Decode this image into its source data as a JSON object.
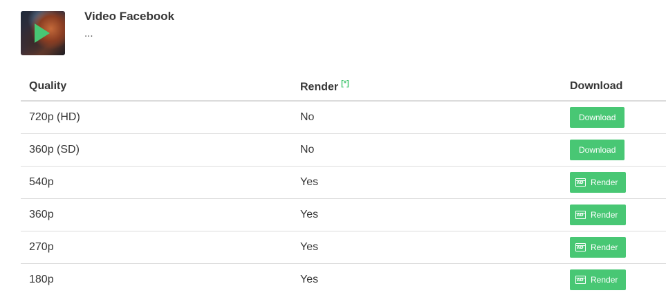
{
  "header": {
    "title": "Video Facebook",
    "subtitle": "..."
  },
  "table": {
    "headers": {
      "quality": "Quality",
      "render": "Render",
      "render_note": "[*]",
      "download": "Download"
    },
    "rows": [
      {
        "quality": "720p (HD)",
        "render": "No",
        "action": "Download"
      },
      {
        "quality": "360p (SD)",
        "render": "No",
        "action": "Download"
      },
      {
        "quality": "540p",
        "render": "Yes",
        "action": "Render"
      },
      {
        "quality": "360p",
        "render": "Yes",
        "action": "Render"
      },
      {
        "quality": "270p",
        "render": "Yes",
        "action": "Render"
      },
      {
        "quality": "180p",
        "render": "Yes",
        "action": "Render"
      }
    ],
    "render_icon_text": "AD"
  },
  "colors": {
    "accent": "#48c774",
    "text": "#363636",
    "border": "#dbdbdb"
  },
  "icons": {
    "thumbnail": "video-thumbnail",
    "play": "play-icon",
    "render": "ad-icon"
  }
}
